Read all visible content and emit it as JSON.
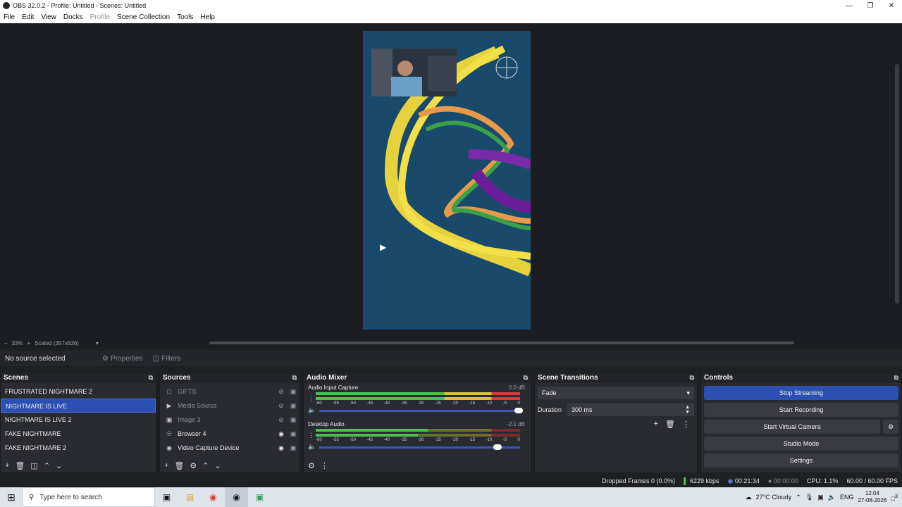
{
  "window": {
    "title": "OBS 32.0.2 - Profile: Untitled - Scenes: Untitled"
  },
  "menu": {
    "items": [
      "File",
      "Edit",
      "View",
      "Docks",
      "Profile",
      "Scene Collection",
      "Tools",
      "Help"
    ]
  },
  "preview": {
    "zoom": "33%",
    "scale_mode": "Scaled (357x636)"
  },
  "source_toolbar": {
    "selection": "No source selected",
    "properties_label": "Properties",
    "filters_label": "Filters"
  },
  "scenes": {
    "title": "Scenes",
    "items": [
      "FRUSTRATED NIGHTMARE 2",
      "NIGHTMARE IS LIVE",
      "NIGHTMARE IS LIVE 2",
      "FAKE NIGHTMARE",
      "FAKE NIGHTMARE 2"
    ],
    "selected_index": 1
  },
  "sources": {
    "title": "Sources",
    "items": [
      {
        "name": "GIFTS",
        "icon": "gif-icon",
        "visible": false
      },
      {
        "name": "Media Source",
        "icon": "play-icon",
        "visible": false
      },
      {
        "name": "Image 3",
        "icon": "image-icon",
        "visible": false
      },
      {
        "name": "Browser 4",
        "icon": "globe-icon",
        "visible": true
      },
      {
        "name": "Video Capture Device",
        "icon": "camera-icon",
        "visible": true
      }
    ]
  },
  "mixer": {
    "title": "Audio Mixer",
    "tick_labels": [
      "-60",
      "-55",
      "-50",
      "-45",
      "-40",
      "-35",
      "-30",
      "-25",
      "-20",
      "-15",
      "-10",
      "-5",
      "0"
    ],
    "channels": [
      {
        "name": "Audio Input Capture",
        "db": "0.0 dB",
        "volume": 1.0
      },
      {
        "name": "Desktop Audio",
        "db": "-2.1 dB",
        "volume": 0.88
      }
    ]
  },
  "transitions": {
    "title": "Scene Transitions",
    "type": "Fade",
    "duration_label": "Duration",
    "duration_value": "300 ms"
  },
  "controls": {
    "title": "Controls",
    "stop_streaming": "Stop Streaming",
    "start_recording": "Start Recording",
    "start_virtual_camera": "Start Virtual Camera",
    "studio_mode": "Studio Mode",
    "settings": "Settings"
  },
  "status": {
    "dropped_frames": "Dropped Frames 0 (0.0%)",
    "bitrate": "6229 kbps",
    "stream_time": "00:21:34",
    "record_time": "00:00:00",
    "cpu": "CPU: 1.1%",
    "fps": "60.00 / 60.00 FPS"
  },
  "taskbar": {
    "search_placeholder": "Type here to search",
    "weather": "27°C  Cloudy",
    "language": "ENG",
    "time": "12:04",
    "date": "27-08-2026",
    "notifications": "3"
  },
  "colors": {
    "accent": "#2b4fb3",
    "canvas_bg": "#1a4a6b",
    "meter_green": "#4cc04c",
    "meter_yellow": "#d8c23a",
    "meter_red": "#d83a3a"
  }
}
